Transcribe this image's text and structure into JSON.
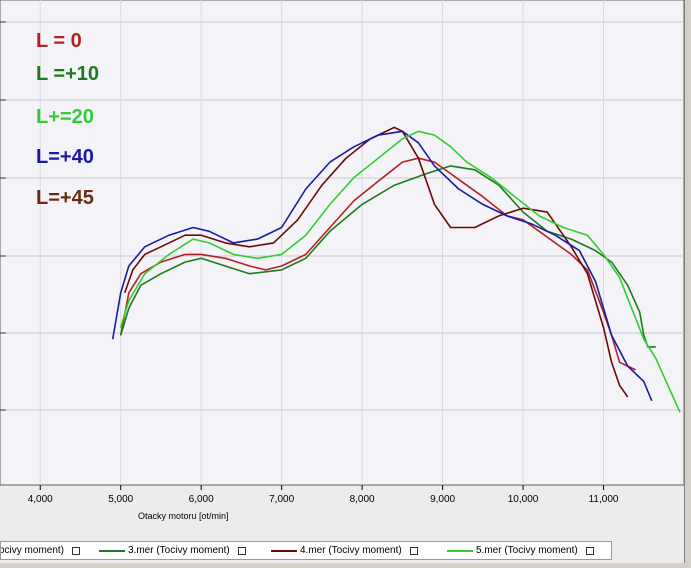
{
  "chart_data": {
    "type": "line",
    "xlabel": "Otacky motoru [ot/min]",
    "ylabel": "",
    "xlim": [
      3500,
      12000
    ],
    "ylim": [
      0,
      1
    ],
    "xticks": [
      "4,000",
      "5,000",
      "6,000",
      "7,000",
      "8,000",
      "9,000",
      "10,000",
      "11,000"
    ],
    "grid": true,
    "annotations": [
      {
        "text": "L = 0",
        "color": "#b22222"
      },
      {
        "text": "L =+10",
        "color": "#1e7a1e"
      },
      {
        "text": "L+=20",
        "color": "#33cc33"
      },
      {
        "text": "L=+40",
        "color": "#1a1aa6"
      },
      {
        "text": "L=+45",
        "color": "#6b2a14"
      }
    ],
    "legend": [
      {
        "label": "ocivy moment)",
        "color": "#0000a0"
      },
      {
        "label": "3.mer  (Tocivy moment)",
        "color": "#1e7a1e"
      },
      {
        "label": "4.mer  (Tocivy moment)",
        "color": "#6b0a0a"
      },
      {
        "label": "5.mer  (Tocivy moment)",
        "color": "#33cc33"
      }
    ],
    "series": [
      {
        "color": "#b22222",
        "x": [
          5000,
          5100,
          5250,
          5500,
          5800,
          6000,
          6300,
          6600,
          6800,
          7000,
          7300,
          7600,
          7900,
          8200,
          8500,
          8700,
          8900,
          9100,
          9300,
          9500,
          9800,
          10000,
          10200,
          10400,
          10600,
          10800,
          11000,
          11100,
          11200,
          11300,
          11400
        ],
        "y": [
          0.22,
          0.33,
          0.38,
          0.41,
          0.43,
          0.43,
          0.42,
          0.4,
          0.39,
          0.4,
          0.43,
          0.5,
          0.57,
          0.62,
          0.67,
          0.68,
          0.67,
          0.64,
          0.61,
          0.58,
          0.53,
          0.52,
          0.49,
          0.46,
          0.43,
          0.39,
          0.28,
          0.22,
          0.15,
          0.14,
          0.13
        ]
      },
      {
        "color": "#1e7a1e",
        "x": [
          5000,
          5100,
          5250,
          5500,
          5800,
          6000,
          6300,
          6600,
          7000,
          7300,
          7600,
          8000,
          8400,
          8800,
          9100,
          9400,
          9700,
          10000,
          10300,
          10600,
          10900,
          11100,
          11300,
          11450,
          11500,
          11550,
          11600,
          11650
        ],
        "y": [
          0.22,
          0.29,
          0.35,
          0.38,
          0.41,
          0.42,
          0.4,
          0.38,
          0.39,
          0.42,
          0.49,
          0.56,
          0.61,
          0.64,
          0.66,
          0.65,
          0.61,
          0.54,
          0.49,
          0.47,
          0.44,
          0.41,
          0.35,
          0.28,
          0.22,
          0.19,
          0.19,
          0.19
        ]
      },
      {
        "color": "#6b0a0a",
        "x": [
          5050,
          5150,
          5300,
          5500,
          5800,
          6000,
          6300,
          6600,
          6900,
          7200,
          7500,
          7800,
          8100,
          8400,
          8500,
          8700,
          8900,
          9100,
          9400,
          9700,
          10000,
          10300,
          10600,
          10800,
          11000,
          11100,
          11200,
          11300
        ],
        "y": [
          0.33,
          0.39,
          0.43,
          0.45,
          0.48,
          0.48,
          0.46,
          0.45,
          0.46,
          0.52,
          0.61,
          0.68,
          0.73,
          0.76,
          0.75,
          0.68,
          0.56,
          0.5,
          0.5,
          0.53,
          0.55,
          0.54,
          0.45,
          0.38,
          0.24,
          0.15,
          0.09,
          0.06
        ]
      },
      {
        "color": "#1a1aa6",
        "x": [
          4900,
          5000,
          5100,
          5300,
          5600,
          5900,
          6100,
          6400,
          6700,
          7000,
          7300,
          7600,
          7900,
          8200,
          8500,
          8700,
          8900,
          9200,
          9500,
          9800,
          10100,
          10400,
          10700,
          10900,
          11100,
          11300,
          11500,
          11600
        ],
        "y": [
          0.21,
          0.33,
          0.4,
          0.45,
          0.48,
          0.5,
          0.49,
          0.46,
          0.47,
          0.5,
          0.6,
          0.67,
          0.71,
          0.74,
          0.75,
          0.72,
          0.66,
          0.6,
          0.56,
          0.53,
          0.51,
          0.48,
          0.44,
          0.36,
          0.22,
          0.14,
          0.1,
          0.05
        ]
      },
      {
        "color": "#33cc33",
        "x": [
          5000,
          5100,
          5300,
          5600,
          5900,
          6100,
          6400,
          6700,
          7000,
          7300,
          7600,
          7900,
          8200,
          8500,
          8700,
          8900,
          9100,
          9300,
          9600,
          9900,
          10200,
          10500,
          10800,
          11000,
          11200,
          11350,
          11500,
          11650,
          11800,
          11950
        ],
        "y": [
          0.24,
          0.31,
          0.38,
          0.43,
          0.47,
          0.46,
          0.43,
          0.42,
          0.43,
          0.48,
          0.56,
          0.63,
          0.68,
          0.73,
          0.75,
          0.74,
          0.71,
          0.67,
          0.63,
          0.58,
          0.53,
          0.5,
          0.48,
          0.43,
          0.37,
          0.29,
          0.21,
          0.16,
          0.09,
          0.02
        ]
      }
    ]
  }
}
